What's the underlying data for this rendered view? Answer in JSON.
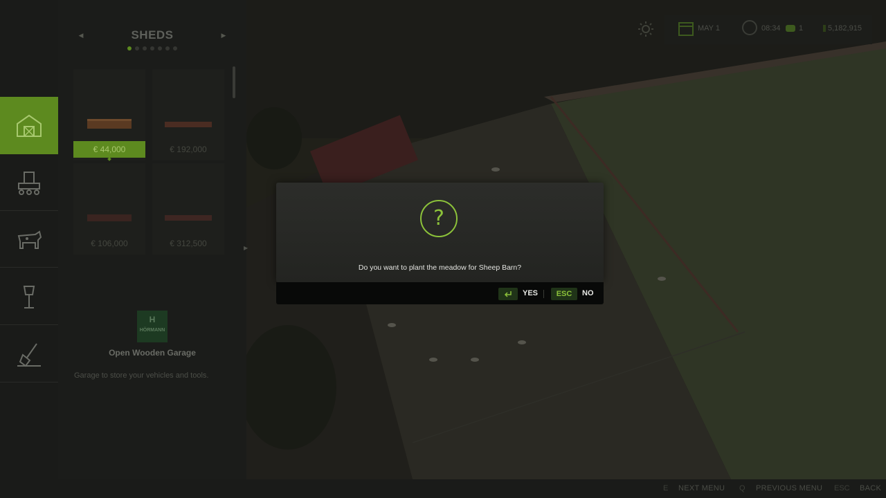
{
  "store": {
    "category_title": "SHEDS",
    "page_count": 7,
    "active_page": 0,
    "items": [
      {
        "price": "€ 44,000",
        "selected": true
      },
      {
        "price": "€ 192,000",
        "selected": false
      },
      {
        "price": "€ 106,000",
        "selected": false
      },
      {
        "price": "€ 312,500",
        "selected": false
      }
    ],
    "selected_item": {
      "brand_logo_text": "HÖRMANN",
      "name": "Open Wooden Garage",
      "description": "Garage to store your vehicles and tools."
    },
    "category_tabs": [
      {
        "icon": "barn-icon",
        "active": true
      },
      {
        "icon": "production-icon",
        "active": false
      },
      {
        "icon": "cow-icon",
        "active": false
      },
      {
        "icon": "lamp-post-icon",
        "active": false
      },
      {
        "icon": "shovel-icon",
        "active": false
      }
    ]
  },
  "hud": {
    "weather_icon": "sun-icon",
    "date": "MAY 1",
    "time": "08:34",
    "time_scale": "1",
    "money": "5,182,915"
  },
  "bottom_hints": [
    {
      "key": "E",
      "label": "NEXT MENU"
    },
    {
      "key": "Q",
      "label": "PREVIOUS MENU"
    },
    {
      "key": "ESC",
      "label": "BACK"
    }
  ],
  "dialog": {
    "icon": "question-mark-icon",
    "icon_glyph": "?",
    "message": "Do you want to plant the meadow for Sheep Barn?",
    "yes_key_icon": "enter-key-icon",
    "yes_label": "YES",
    "no_key": "ESC",
    "no_label": "NO"
  },
  "colors": {
    "accent_green": "#8cc23a",
    "selected_green": "#5d8a1f",
    "dialog_bg": "#2a2b28"
  }
}
